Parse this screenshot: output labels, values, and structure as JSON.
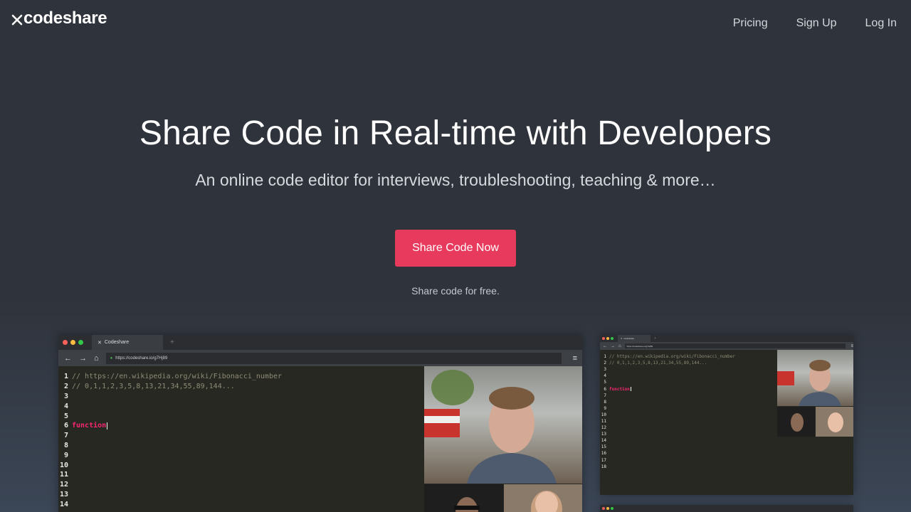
{
  "header": {
    "logo_text": "codeshare",
    "nav": [
      {
        "label": "Pricing"
      },
      {
        "label": "Sign Up"
      },
      {
        "label": "Log In"
      }
    ]
  },
  "hero": {
    "title": "Share Code in Real-time with Developers",
    "subtitle": "An online code editor for interviews, troubleshooting, teaching & more…",
    "cta_label": "Share Code Now",
    "note": "Share code for free."
  },
  "colors": {
    "background": "#2f333b",
    "cta": "#e83a5c",
    "editor_bg": "#272822",
    "keyword": "#f92672",
    "comment": "#8e8b76"
  },
  "screenshot_large": {
    "tab_title": "Codeshare",
    "url": "https://codeshare.io/g7Hj89",
    "code_lines": [
      {
        "n": "1",
        "text": "// https://en.wikipedia.org/wiki/Fibonacci_number",
        "kind": "comment"
      },
      {
        "n": "2",
        "text": "// 0,1,1,2,3,5,8,13,21,34,55,89,144...",
        "kind": "comment"
      },
      {
        "n": "3",
        "text": "",
        "kind": "plain"
      },
      {
        "n": "4",
        "text": "",
        "kind": "plain"
      },
      {
        "n": "5",
        "text": "",
        "kind": "plain"
      },
      {
        "n": "6",
        "text": "function",
        "kind": "keyword"
      },
      {
        "n": "7",
        "text": "",
        "kind": "plain"
      },
      {
        "n": "8",
        "text": "",
        "kind": "plain"
      },
      {
        "n": "9",
        "text": "",
        "kind": "plain"
      },
      {
        "n": "10",
        "text": "",
        "kind": "plain"
      },
      {
        "n": "11",
        "text": "",
        "kind": "plain"
      },
      {
        "n": "12",
        "text": "",
        "kind": "plain"
      },
      {
        "n": "13",
        "text": "",
        "kind": "plain"
      },
      {
        "n": "14",
        "text": "",
        "kind": "plain"
      }
    ]
  },
  "screenshot_small": {
    "tab_title": "Codeshare",
    "url": "https://codeshare.io/g7Hj89",
    "code_lines": [
      {
        "n": "1",
        "text": "// https://en.wikipedia.org/wiki/Fibonacci_number",
        "kind": "comment"
      },
      {
        "n": "2",
        "text": "// 0,1,1,2,3,5,8,13,21,34,55,89,144...",
        "kind": "comment"
      },
      {
        "n": "3",
        "text": "",
        "kind": "plain"
      },
      {
        "n": "4",
        "text": "",
        "kind": "plain"
      },
      {
        "n": "5",
        "text": "",
        "kind": "plain"
      },
      {
        "n": "6",
        "text": "function",
        "kind": "keyword"
      },
      {
        "n": "7",
        "text": "",
        "kind": "plain"
      },
      {
        "n": "8",
        "text": "",
        "kind": "plain"
      },
      {
        "n": "9",
        "text": "",
        "kind": "plain"
      },
      {
        "n": "10",
        "text": "",
        "kind": "plain"
      },
      {
        "n": "11",
        "text": "",
        "kind": "plain"
      },
      {
        "n": "12",
        "text": "",
        "kind": "plain"
      },
      {
        "n": "13",
        "text": "",
        "kind": "plain"
      },
      {
        "n": "14",
        "text": "",
        "kind": "plain"
      },
      {
        "n": "15",
        "text": "",
        "kind": "plain"
      },
      {
        "n": "16",
        "text": "",
        "kind": "plain"
      },
      {
        "n": "17",
        "text": "",
        "kind": "plain"
      },
      {
        "n": "18",
        "text": "",
        "kind": "plain"
      }
    ]
  }
}
